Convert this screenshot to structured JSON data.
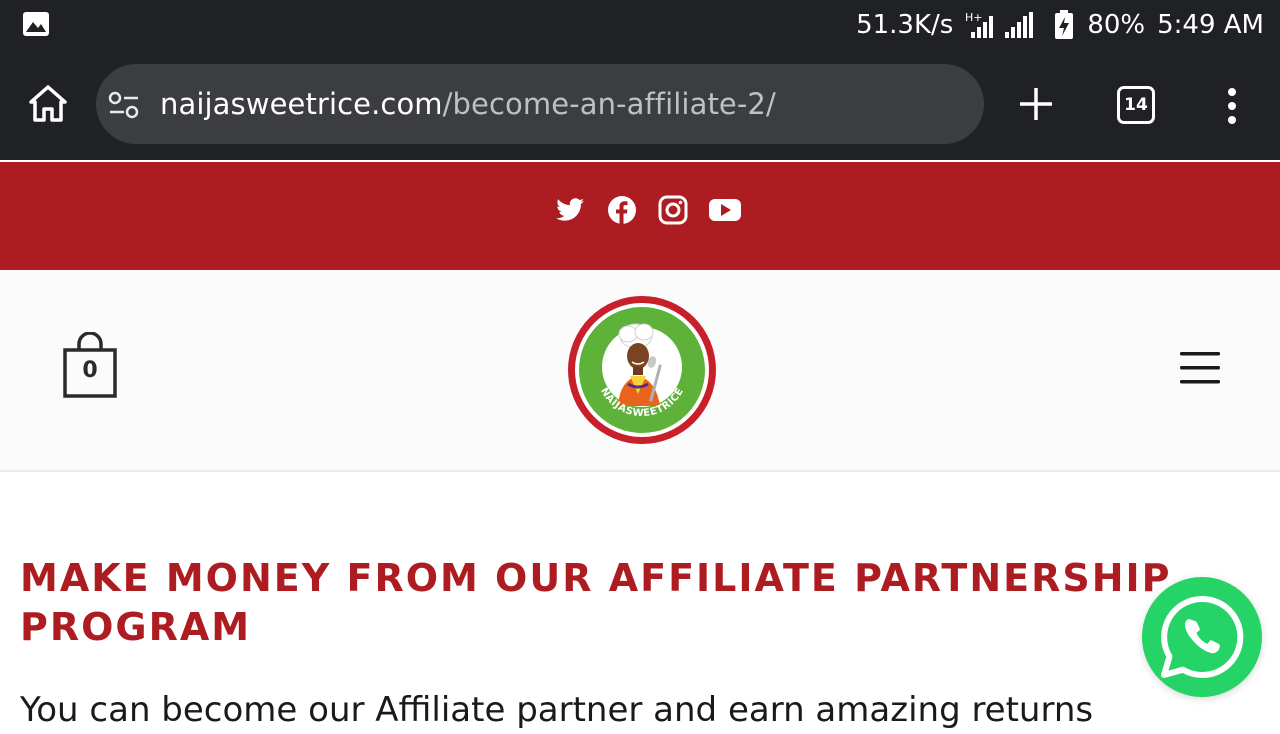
{
  "status_bar": {
    "net_speed": "51.3K/s",
    "network_type": "H+",
    "battery": "80%",
    "time": "5:49 AM"
  },
  "browser": {
    "url_host": "naijasweetrice.com",
    "url_path": "/become-an-affiliate-2/",
    "tab_count": "14"
  },
  "social": {
    "icons": [
      "twitter-icon",
      "facebook-icon",
      "instagram-icon",
      "youtube-icon"
    ]
  },
  "header": {
    "cart_count": "0",
    "logo_text": "NAIJASWEETRICE"
  },
  "main": {
    "heading": "MAKE MONEY FROM OUR AFFILIATE PARTNERSHIP PROGRAM",
    "intro": "You can become our Affiliate partner and earn amazing returns"
  },
  "colors": {
    "brand_red": "#ad1c21",
    "whatsapp_green": "#25d366",
    "chrome_dark": "#202124"
  }
}
